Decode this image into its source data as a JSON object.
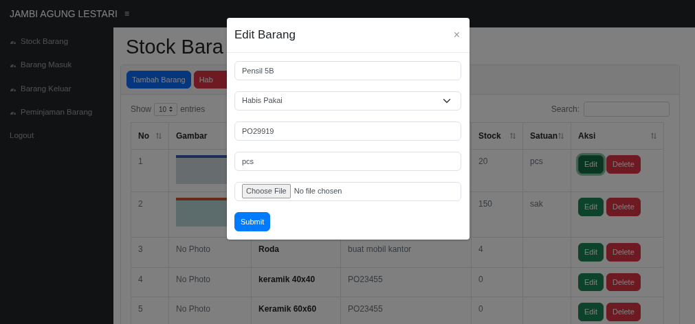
{
  "brand": "JAMBI AGUNG LESTARI",
  "menu_toggle": "≡",
  "sidebar": {
    "items": [
      {
        "label": "Stock Barang",
        "icon": true
      },
      {
        "label": "Barang Masuk",
        "icon": true
      },
      {
        "label": "Barang Keluar",
        "icon": true
      },
      {
        "label": "Peminjaman Barang",
        "icon": true
      },
      {
        "label": "Logout",
        "icon": false
      }
    ]
  },
  "page_title": "Stock Bara",
  "toolbar_buttons": [
    {
      "label": "Tambah Barang",
      "kind": "primary"
    },
    {
      "label": "Hab",
      "kind": "danger"
    }
  ],
  "length_menu": {
    "before": "Show",
    "value": "10",
    "after": "entries"
  },
  "search": {
    "label": "Search:"
  },
  "table": {
    "columns": [
      {
        "label": "No",
        "sortable": true
      },
      {
        "label": "Gambar"
      },
      {},
      {},
      {
        "label": "Stock",
        "sortable": true
      },
      {
        "label": "Satuan",
        "sortable": true
      },
      {
        "label": "Aksi",
        "sortable": true
      }
    ],
    "rows": [
      {
        "no": "1",
        "photo": true,
        "stock": "20",
        "satuan": "pcs",
        "edit": "Edit",
        "delete": "Delete",
        "edit_focused": true
      },
      {
        "no": "2",
        "photo": true,
        "stock": "150",
        "satuan": "sak",
        "edit": "Edit",
        "delete": "Delete",
        "edit_focused": false
      },
      {
        "no": "3",
        "photo": false,
        "gambar": "No Photo",
        "nama": "Roda",
        "keterangan": "buat mobil kantor",
        "stock": "4",
        "edit": "Edit",
        "delete": "Delete",
        "edit_focused": false
      },
      {
        "no": "4",
        "photo": false,
        "gambar": "No Photo",
        "nama": "keramik 40x40",
        "keterangan": "PO23455",
        "stock": "0",
        "edit": "Edit",
        "delete": "Delete",
        "edit_focused": false
      },
      {
        "no": "5",
        "photo": false,
        "gambar": "No Photo",
        "nama": "Keramik 60x60",
        "keterangan": "PO23455",
        "stock": "0",
        "edit": "Edit",
        "delete": "Delete",
        "edit_focused": false
      }
    ]
  },
  "modal": {
    "title": "Edit Barang",
    "close": "×",
    "fields": [
      {
        "kind": "text",
        "value": "Pensil 5B"
      },
      {
        "kind": "select",
        "value": "Habis Pakai"
      },
      {
        "kind": "text",
        "value": "PO29919"
      },
      {
        "kind": "text",
        "value": "pcs"
      },
      {
        "kind": "file",
        "button": "Choose File",
        "status": "No file chosen"
      }
    ],
    "submit": "Submit"
  }
}
